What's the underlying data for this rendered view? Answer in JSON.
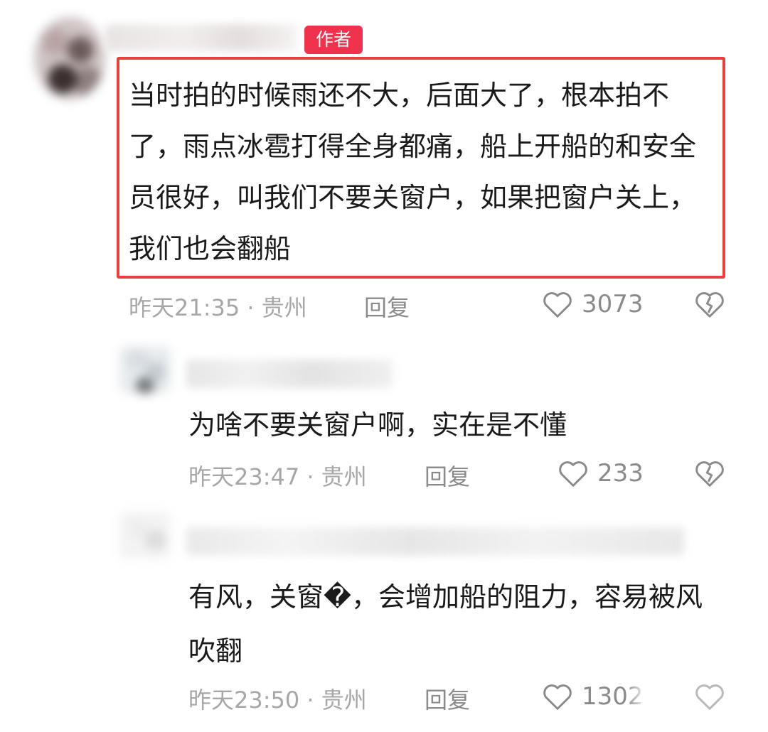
{
  "main_comment": {
    "badge": "作者",
    "text": "当时拍的时候雨还不大，后面大了，根本拍不了，雨点冰雹打得全身都痛，船上开船的和安全员很好，叫我们不要关窗户，如果把窗户关上，我们也会翻船",
    "time": "昨天21:35",
    "location": "贵州",
    "reply_label": "回复",
    "likes": "3073",
    "highlight_color": "#e8413d"
  },
  "replies": [
    {
      "text": "为啥不要关窗户啊，实在是不懂",
      "time": "昨天23:47",
      "location": "贵州",
      "reply_label": "回复",
      "likes": "233"
    },
    {
      "text": "有风，关窗�，会增加船的阻力，容易被风吹翻",
      "time": "昨天23:50",
      "location": "贵州",
      "reply_label": "回复",
      "likes": "1302"
    }
  ],
  "separator": " · ",
  "icons": {
    "like": "heart-outline-icon",
    "dislike": "broken-heart-icon"
  },
  "colors": {
    "badge_bg": "#f0324f",
    "meta_text": "#a7a7a7"
  }
}
